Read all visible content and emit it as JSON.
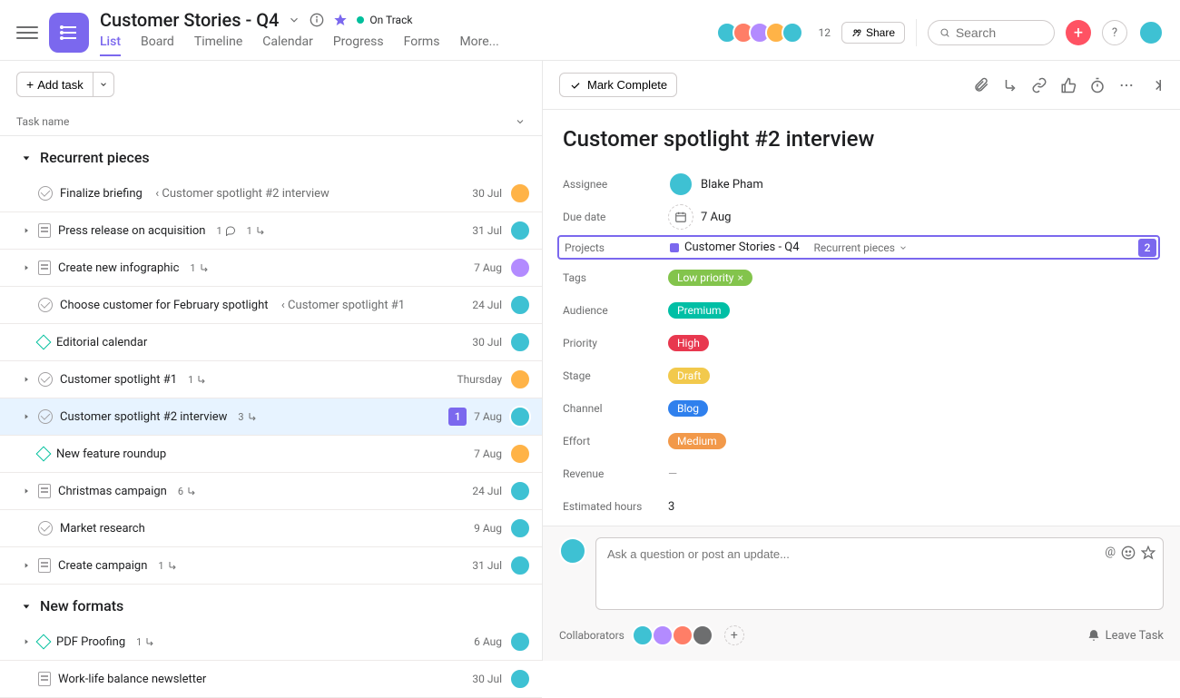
{
  "project": {
    "title": "Customer Stories - Q4",
    "status": "On Track",
    "tabs": [
      "List",
      "Board",
      "Timeline",
      "Calendar",
      "Progress",
      "Forms",
      "More..."
    ],
    "active_tab": "List",
    "member_count": "12",
    "share_label": "Share"
  },
  "search": {
    "placeholder": "Search"
  },
  "toolbar": {
    "add_task": "Add task"
  },
  "columns": {
    "task_name": "Task name"
  },
  "sections": [
    {
      "name": "Recurrent pieces",
      "tasks": [
        {
          "icon": "check",
          "name": "Finalize briefing",
          "parent": "‹ Customer spotlight #2 interview",
          "due": "30 Jul",
          "avatar": "#ffb347",
          "expandable": false
        },
        {
          "icon": "doc",
          "name": "Press release on acquisition",
          "meta": [
            {
              "t": "comment",
              "n": "1"
            },
            {
              "t": "subtask",
              "n": "1"
            }
          ],
          "due": "31 Jul",
          "avatar": "#3ec1d3",
          "expandable": true
        },
        {
          "icon": "doc",
          "name": "Create new infographic",
          "meta": [
            {
              "t": "subtask",
              "n": "1"
            }
          ],
          "due": "7 Aug",
          "avatar": "#b38bff",
          "expandable": true
        },
        {
          "icon": "check",
          "name": "Choose customer for February spotlight",
          "parent": "‹ Customer spotlight #1",
          "due": "24 Jul",
          "avatar": "#3ec1d3",
          "expandable": false
        },
        {
          "icon": "ms",
          "name": "Editorial calendar",
          "due": "30 Jul",
          "avatar": "#3ec1d3",
          "expandable": false
        },
        {
          "icon": "check",
          "name": "Customer spotlight #1",
          "meta": [
            {
              "t": "subtask",
              "n": "1"
            }
          ],
          "due": "Thursday",
          "avatar": "#ffb347",
          "expandable": true
        },
        {
          "icon": "check",
          "name": "Customer spotlight #2 interview",
          "meta": [
            {
              "t": "subtask",
              "n": "3"
            }
          ],
          "due": "7 Aug",
          "avatar": "#3ec1d3",
          "expandable": true,
          "selected": true,
          "callout": "1"
        },
        {
          "icon": "ms",
          "name": "New feature roundup",
          "due": "7 Aug",
          "avatar": "#ffb347",
          "expandable": false
        },
        {
          "icon": "doc",
          "name": "Christmas campaign",
          "meta": [
            {
              "t": "subtask",
              "n": "6"
            }
          ],
          "due": "24 Jul",
          "avatar": "#3ec1d3",
          "expandable": true
        },
        {
          "icon": "check",
          "name": "Market research",
          "due": "9 Aug",
          "avatar": "#3ec1d3",
          "expandable": false
        },
        {
          "icon": "doc",
          "name": "Create campaign",
          "meta": [
            {
              "t": "subtask",
              "n": "1"
            }
          ],
          "due": "31 Jul",
          "avatar": "#3ec1d3",
          "expandable": true
        }
      ]
    },
    {
      "name": "New formats",
      "tasks": [
        {
          "icon": "ms",
          "name": "PDF Proofing",
          "meta": [
            {
              "t": "subtask",
              "n": "1"
            }
          ],
          "due": "6 Aug",
          "avatar": "#3ec1d3",
          "expandable": true
        },
        {
          "icon": "doc",
          "name": "Work-life balance newsletter",
          "due": "30 Jul",
          "avatar": "#3ec1d3",
          "expandable": false
        }
      ]
    }
  ],
  "detail": {
    "mark_complete": "Mark Complete",
    "title": "Customer spotlight #2 interview",
    "fields": {
      "assignee_label": "Assignee",
      "assignee": "Blake Pham",
      "due_label": "Due date",
      "due": "7 Aug",
      "projects_label": "Projects",
      "project_name": "Customer Stories - Q4",
      "project_section": "Recurrent pieces",
      "project_callout": "2",
      "tags_label": "Tags",
      "tags": [
        {
          "text": "Low priority",
          "color": "#83c44c",
          "removable": true
        }
      ],
      "audience_label": "Audience",
      "audience": {
        "text": "Premium",
        "color": "#00bfa5"
      },
      "priority_label": "Priority",
      "priority": {
        "text": "High",
        "color": "#e8384f"
      },
      "stage_label": "Stage",
      "stage": {
        "text": "Draft",
        "color": "#f2c94c"
      },
      "channel_label": "Channel",
      "channel": {
        "text": "Blog",
        "color": "#2f80ed"
      },
      "effort_label": "Effort",
      "effort": {
        "text": "Medium",
        "color": "#f2994a"
      },
      "revenue_label": "Revenue",
      "revenue": "—",
      "est_hours_label": "Estimated hours",
      "est_hours": "3"
    },
    "comment_placeholder": "Ask a question or post an update...",
    "collaborators_label": "Collaborators",
    "leave_task": "Leave Task"
  },
  "colors": {
    "avatars_top": [
      "#3ec1d3",
      "#ff7e67",
      "#b38bff",
      "#ffb347",
      "#3ec1d3"
    ],
    "assignee_av": "#3ec1d3",
    "self_av": "#3ec1d3",
    "collab_avs": [
      "#3ec1d3",
      "#b38bff",
      "#ff7e67",
      "#6d6e6f"
    ]
  }
}
